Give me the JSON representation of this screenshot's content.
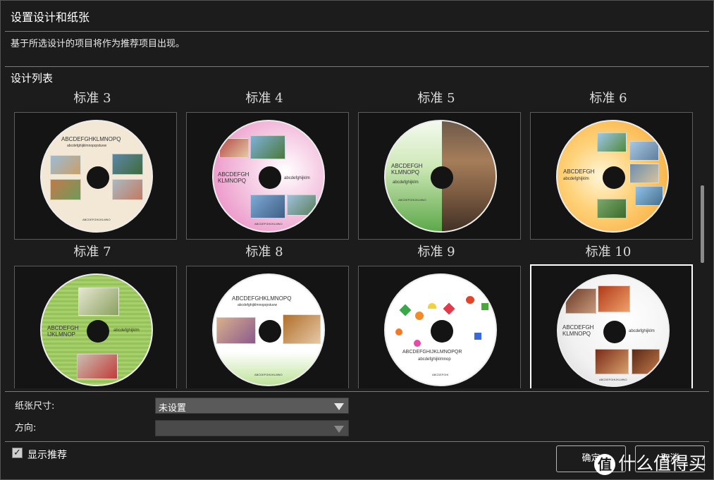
{
  "dialog": {
    "title": "设置设计和纸张",
    "description": "基于所选设计的项目将作为推荐项目出现。",
    "section_label": "设计列表"
  },
  "designs": [
    {
      "label": "标准 3",
      "text1": "ABCDEFGHKLMNOPQ",
      "text2": "abcdefghijklmnopqrstuvw",
      "text3": "ABCDEFGHIJKLMNO",
      "selected": false
    },
    {
      "label": "标准 4",
      "text1": "ABCDEFGH",
      "text2": "KLMNOPQ",
      "text3": "abcdefghijklm",
      "text4": "ABCDEFGHIJKLMNO",
      "selected": false
    },
    {
      "label": "标准 5",
      "text1": "ABCDEFGH",
      "text2": "KLMNOPQ",
      "text3": "abcdefghijklm",
      "text4": "ABCDEFGHIJKLMNO",
      "selected": false
    },
    {
      "label": "标准 6",
      "text1": "ABCDEFGH",
      "text2": "abcdefghijklm",
      "selected": false
    },
    {
      "label": "标准 7",
      "text1": "ABCDEFGH",
      "text2": "IJKLMNOP",
      "text3": "abcdefghijklm",
      "selected": false
    },
    {
      "label": "标准 8",
      "text1": "ABCDEFGHKLMNOPQ",
      "text2": "abcdefghijklmnopqrstuvw",
      "text3": "ABCDEFGHIJKLMNO",
      "selected": false
    },
    {
      "label": "标准 9",
      "text1": "ABCDEFGHIJKLMNOPQR",
      "text2": "abcdefghijklmnop",
      "text3": "ABCDEFGHI",
      "selected": false
    },
    {
      "label": "标准 10",
      "text1": "ABCDEFGH",
      "text2": "KLMNOPQ",
      "text3": "abcdefghijklm",
      "text4": "ABCDEFGHIJKLMNO",
      "selected": true
    }
  ],
  "form": {
    "paper_size_label": "纸张尺寸:",
    "paper_size_value": "未设置",
    "orientation_label": "方向:",
    "orientation_value": ""
  },
  "footer": {
    "show_recommend_label": "显示推荐",
    "ok_label": "确定",
    "cancel_label": "取消",
    "watermark_text": "什么值得买",
    "watermark_badge": "值"
  },
  "colors": {
    "background": "#1c1c1c",
    "selected_border": "#ffffff"
  }
}
